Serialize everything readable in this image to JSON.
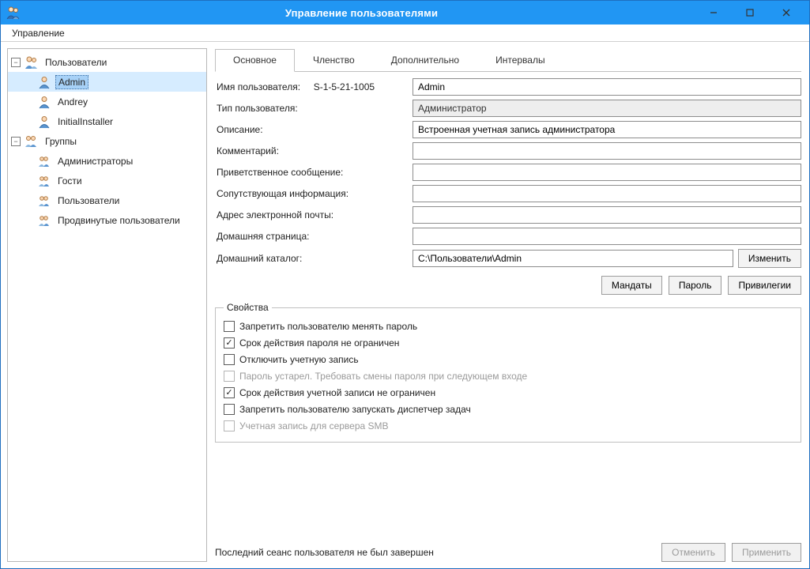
{
  "window": {
    "title": "Управление пользователями"
  },
  "menubar": {
    "manage": "Управление"
  },
  "tree": {
    "users_label": "Пользователи",
    "groups_label": "Группы",
    "users": [
      {
        "label": "Admin"
      },
      {
        "label": "Andrey"
      },
      {
        "label": "InitialInstaller"
      }
    ],
    "groups": [
      {
        "label": "Администраторы"
      },
      {
        "label": "Гости"
      },
      {
        "label": "Пользователи"
      },
      {
        "label": "Продвинутые пользователи"
      }
    ]
  },
  "tabs": {
    "general": "Основное",
    "membership": "Членство",
    "advanced": "Дополнительно",
    "intervals": "Интервалы"
  },
  "form": {
    "username_label": "Имя пользователя:",
    "sid": "S-1-5-21-1005",
    "username_value": "Admin",
    "usertype_label": "Тип пользователя:",
    "usertype_value": "Администратор",
    "description_label": "Описание:",
    "description_value": "Встроенная учетная запись администратора",
    "comment_label": "Комментарий:",
    "comment_value": "",
    "greeting_label": "Приветственное сообщение:",
    "greeting_value": "",
    "related_label": "Сопутствующая информация:",
    "related_value": "",
    "email_label": "Адрес электронной почты:",
    "email_value": "",
    "homepage_label": "Домашняя страница:",
    "homepage_value": "",
    "homedir_label": "Домашний каталог:",
    "homedir_value": "C:\\Пользователи\\Admin",
    "change_btn": "Изменить"
  },
  "buttons": {
    "mandates": "Мандаты",
    "password": "Пароль",
    "privileges": "Привилегии"
  },
  "props": {
    "legend": "Свойства",
    "items": [
      {
        "label": "Запретить пользователю менять пароль",
        "checked": false,
        "disabled": false
      },
      {
        "label": "Срок действия пароля не ограничен",
        "checked": true,
        "disabled": false
      },
      {
        "label": "Отключить учетную запись",
        "checked": false,
        "disabled": false
      },
      {
        "label": "Пароль устарел. Требовать смены пароля при следующем входе",
        "checked": false,
        "disabled": true
      },
      {
        "label": "Срок действия учетной записи не ограничен",
        "checked": true,
        "disabled": false
      },
      {
        "label": "Запретить пользователю запускать диспетчер задач",
        "checked": false,
        "disabled": false
      },
      {
        "label": "Учетная запись для сервера SMB",
        "checked": false,
        "disabled": true
      }
    ]
  },
  "footer": {
    "status": "Последний сеанс пользователя не был завершен",
    "cancel": "Отменить",
    "apply": "Применить"
  }
}
